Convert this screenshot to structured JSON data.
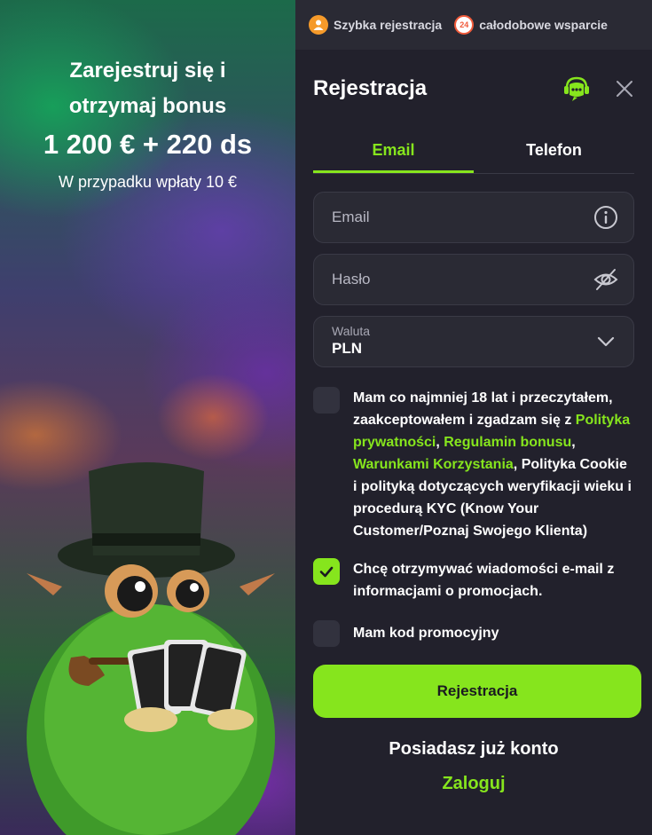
{
  "promo": {
    "line1": "Zarejestruj się i",
    "line2": "otrzymaj bonus",
    "amount": "1 200 € + 220 ds",
    "note": "W przypadku wpłaty 10 €"
  },
  "topbar": {
    "quick_reg": "Szybka rejestracja",
    "support": "całodobowe wsparcie",
    "support_badge": "24"
  },
  "form": {
    "title": "Rejestracja",
    "tabs": [
      {
        "label": "Email",
        "active": true
      },
      {
        "label": "Telefon",
        "active": false
      }
    ],
    "email_placeholder": "Email",
    "password_placeholder": "Hasło",
    "currency_label": "Waluta",
    "currency_value": "PLN",
    "terms": {
      "part1": "Mam co najmniej 18 lat i przeczytałem, zaakceptowałem i zgadzam się z ",
      "link_privacy": "Polityka prywatności",
      "sep1": ", ",
      "link_bonus": "Regulamin bonusu",
      "sep2": ", ",
      "link_terms": "Warunkami Korzystania",
      "part2": ", Polityka Cookie i polityką dotyczących weryfikacji wieku i procedurą KYC (Know Your Customer/Poznaj Swojego Klienta)",
      "checked": false
    },
    "newsletter": {
      "text": "Chcę otrzymywać wiadomości e-mail z informacjami o promocjach.",
      "checked": true
    },
    "promo_code": {
      "text": "Mam kod promocyjny",
      "checked": false
    },
    "submit_label": "Rejestracja",
    "have_account": "Posiadasz już konto",
    "login_label": "Zaloguj"
  },
  "colors": {
    "accent": "#86e51d",
    "panel_bg": "#22212c",
    "field_bg": "#2a2a34"
  },
  "icons": [
    "user-icon",
    "support-24-icon",
    "chat-support-icon",
    "close-icon",
    "info-icon",
    "eye-off-icon",
    "chevron-down-icon",
    "check-icon"
  ]
}
